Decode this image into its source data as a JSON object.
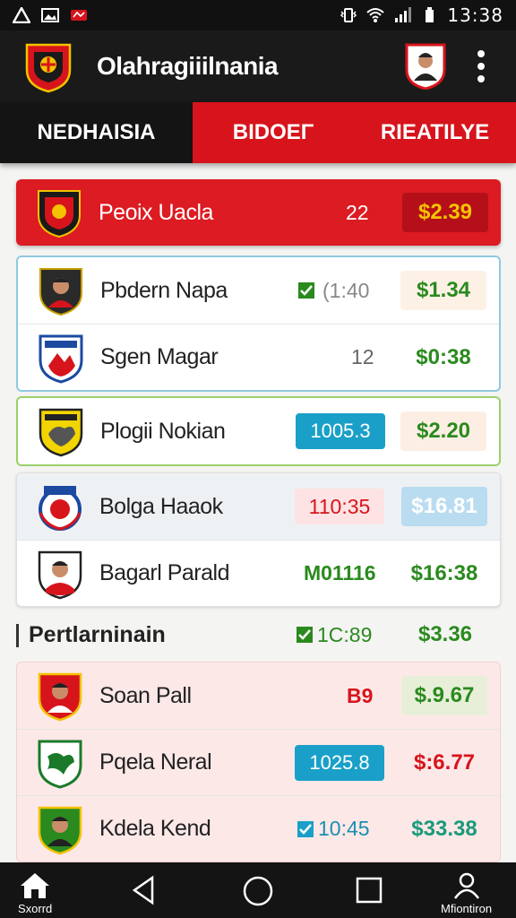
{
  "status_bar": {
    "time": "13:38"
  },
  "app": {
    "title": "Olahragiiilnania"
  },
  "tabs": [
    {
      "label": "NEDHAISIA"
    },
    {
      "label": "BIDOEΓ"
    },
    {
      "label": "RIEATILYE"
    }
  ],
  "section_header": "Pertlarninain",
  "rows": [
    {
      "name": "Peoix Uacla",
      "stat": "22",
      "price": "$2.39"
    },
    {
      "name": "Pbdern Napa",
      "stat": "(1:40",
      "price": "$1.34"
    },
    {
      "name": "Sgen Magar",
      "stat": "12",
      "price": "$0:38"
    },
    {
      "name": "Plogii Nokian",
      "stat": "1005.3",
      "price": "$2.20"
    },
    {
      "name": "Bolga Haaok",
      "stat": "110:35",
      "price": "$16.81"
    },
    {
      "name": "Bagarl Parald",
      "stat": "M01116",
      "price": "$16:38"
    },
    {
      "name": "Soan Pall",
      "stat": "B9",
      "price": "$.9.67"
    },
    {
      "name": "Pqela Neral",
      "stat": "1025.8",
      "price": "$:6.77"
    },
    {
      "name": "Kdela Kend",
      "stat": "10:45",
      "price": "$33.38"
    }
  ],
  "section_row": {
    "stat": "1C:89",
    "price": "$3.36"
  },
  "nav": {
    "home_label": "Sxorrd",
    "profile_label": "Mfiontiron"
  },
  "colors": {
    "brand_red": "#d7141c",
    "dark": "#141414",
    "green": "#2a8a1e",
    "blue_badge": "#1aa0c8"
  }
}
